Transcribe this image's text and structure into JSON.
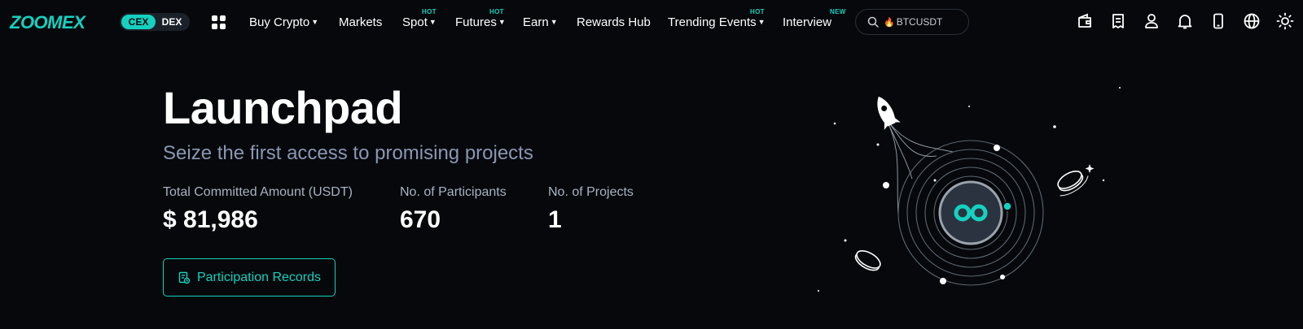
{
  "brand": {
    "logo": "ZOOMEX",
    "toggle_cex": "CEX",
    "toggle_dex": "DEX"
  },
  "nav": {
    "items": [
      {
        "label": "Buy Crypto",
        "has_caret": true,
        "tag": ""
      },
      {
        "label": "Markets",
        "has_caret": false,
        "tag": ""
      },
      {
        "label": "Spot",
        "has_caret": true,
        "tag": "HOT"
      },
      {
        "label": "Futures",
        "has_caret": true,
        "tag": "HOT"
      },
      {
        "label": "Earn",
        "has_caret": true,
        "tag": ""
      },
      {
        "label": "Rewards Hub",
        "has_caret": false,
        "tag": ""
      },
      {
        "label": "Trending Events",
        "has_caret": true,
        "tag": "HOT"
      },
      {
        "label": "Interview",
        "has_caret": false,
        "tag": "NEW"
      }
    ],
    "search": {
      "value": "BTCUSDT",
      "icon": "search-icon",
      "badge_icon": "fire-icon"
    },
    "right_icons": [
      "wallet-icon",
      "orders-icon",
      "user-icon",
      "bell-icon",
      "mobile-icon",
      "globe-icon",
      "theme-sun-icon"
    ]
  },
  "hero": {
    "title": "Launchpad",
    "subtitle": "Seize the first access to promising projects",
    "stats": [
      {
        "label": "Total Committed Amount (USDT)",
        "value": "$ 81,986"
      },
      {
        "label": "No. of Participants",
        "value": "670"
      },
      {
        "label": "No. of Projects",
        "value": "1"
      }
    ],
    "records_button": "Participation Records"
  },
  "colors": {
    "accent": "#14d1c0",
    "background": "#06080b",
    "subtitle": "#8a97b4",
    "label": "#a9b3c4"
  }
}
